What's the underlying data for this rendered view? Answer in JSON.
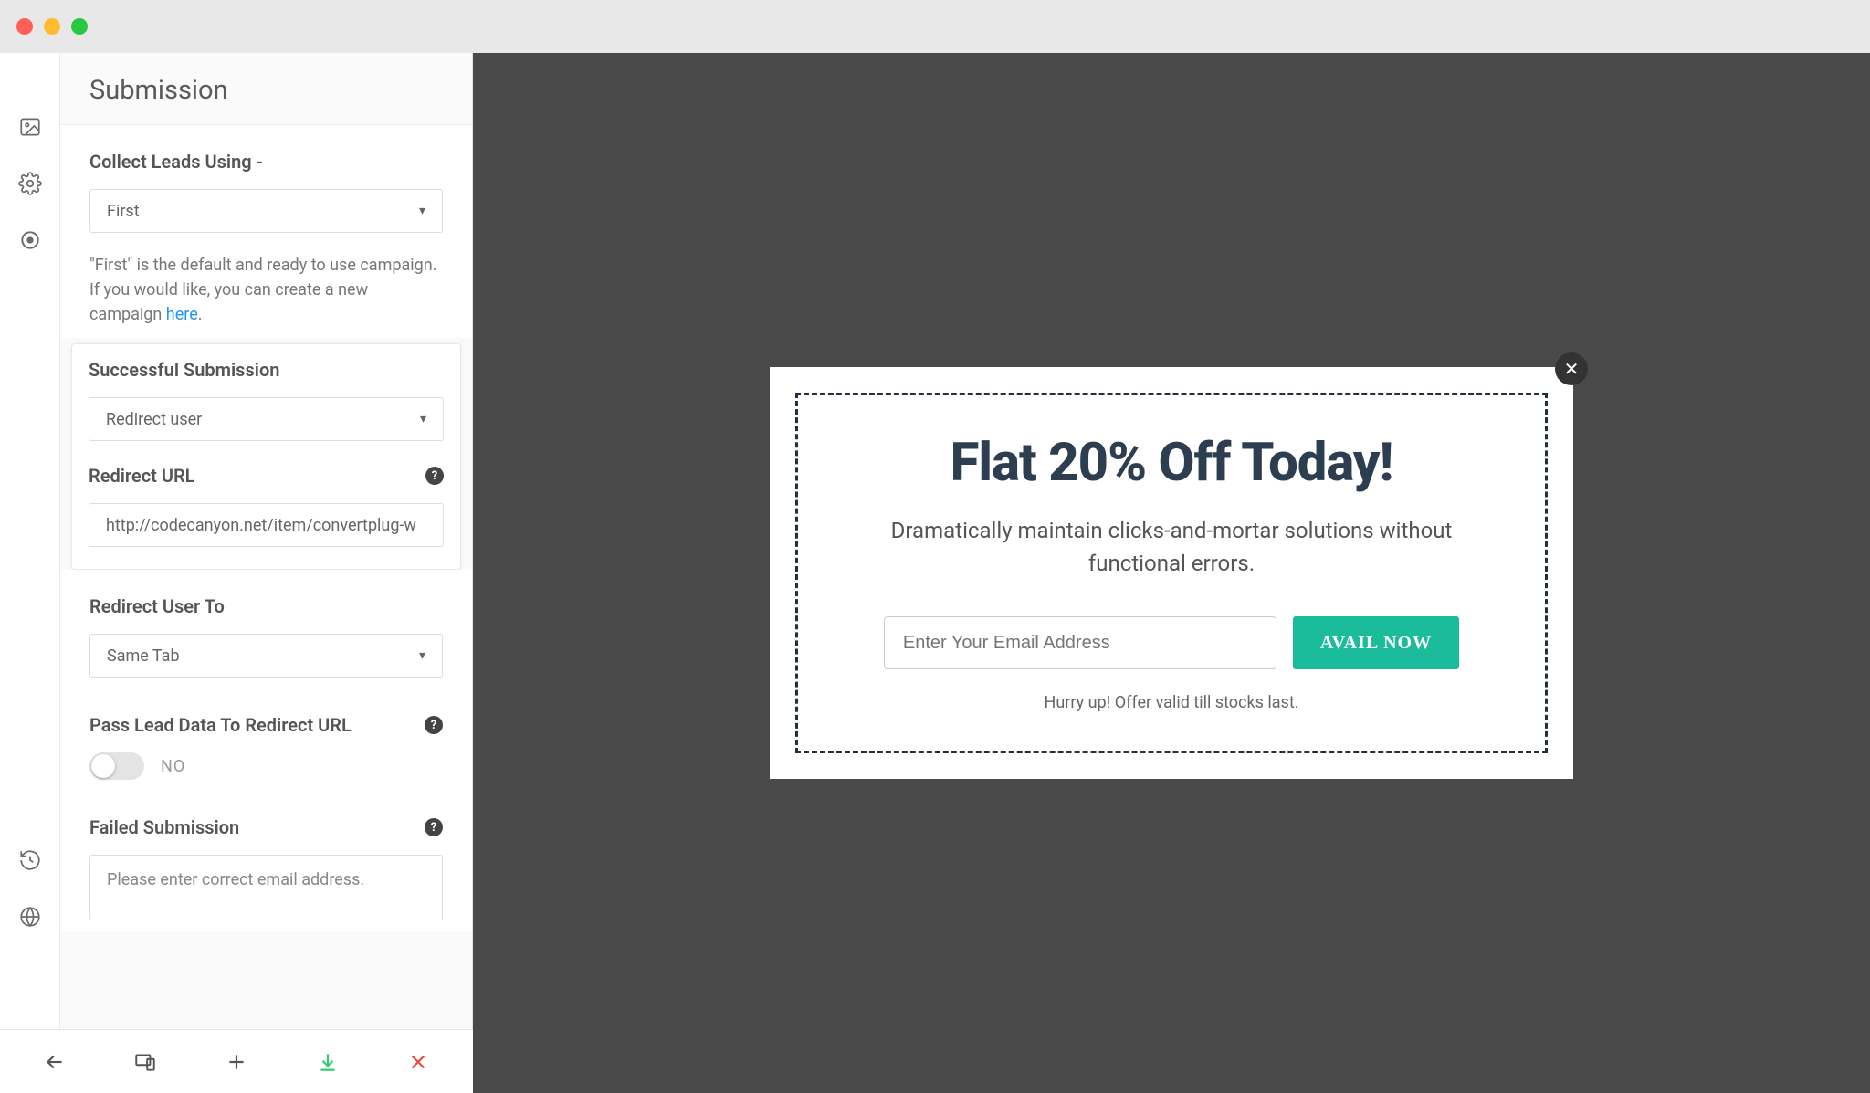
{
  "sidebar": {
    "title": "Submission",
    "collect_leads": {
      "label": "Collect Leads Using -",
      "value": "First",
      "note_prefix": "\"First\" is the default and ready to use campaign. If you would like, you can create a new campaign ",
      "note_link": "here"
    },
    "successful": {
      "label": "Successful Submission",
      "value": "Redirect user"
    },
    "redirect_url": {
      "label": "Redirect URL",
      "value": "http://codecanyon.net/item/convertplug-w"
    },
    "redirect_to": {
      "label": "Redirect User To",
      "value": "Same Tab"
    },
    "pass_lead": {
      "label": "Pass Lead Data To Redirect URL",
      "toggle_state": "NO"
    },
    "failed": {
      "label": "Failed Submission",
      "value": "Please enter correct email address."
    }
  },
  "modal": {
    "heading": "Flat 20% Off Today!",
    "subheading": "Dramatically maintain clicks-and-mortar solutions without functional errors.",
    "email_placeholder": "Enter Your Email Address",
    "cta": "AVAIL NOW",
    "footnote": "Hurry up! Offer valid till stocks last."
  }
}
